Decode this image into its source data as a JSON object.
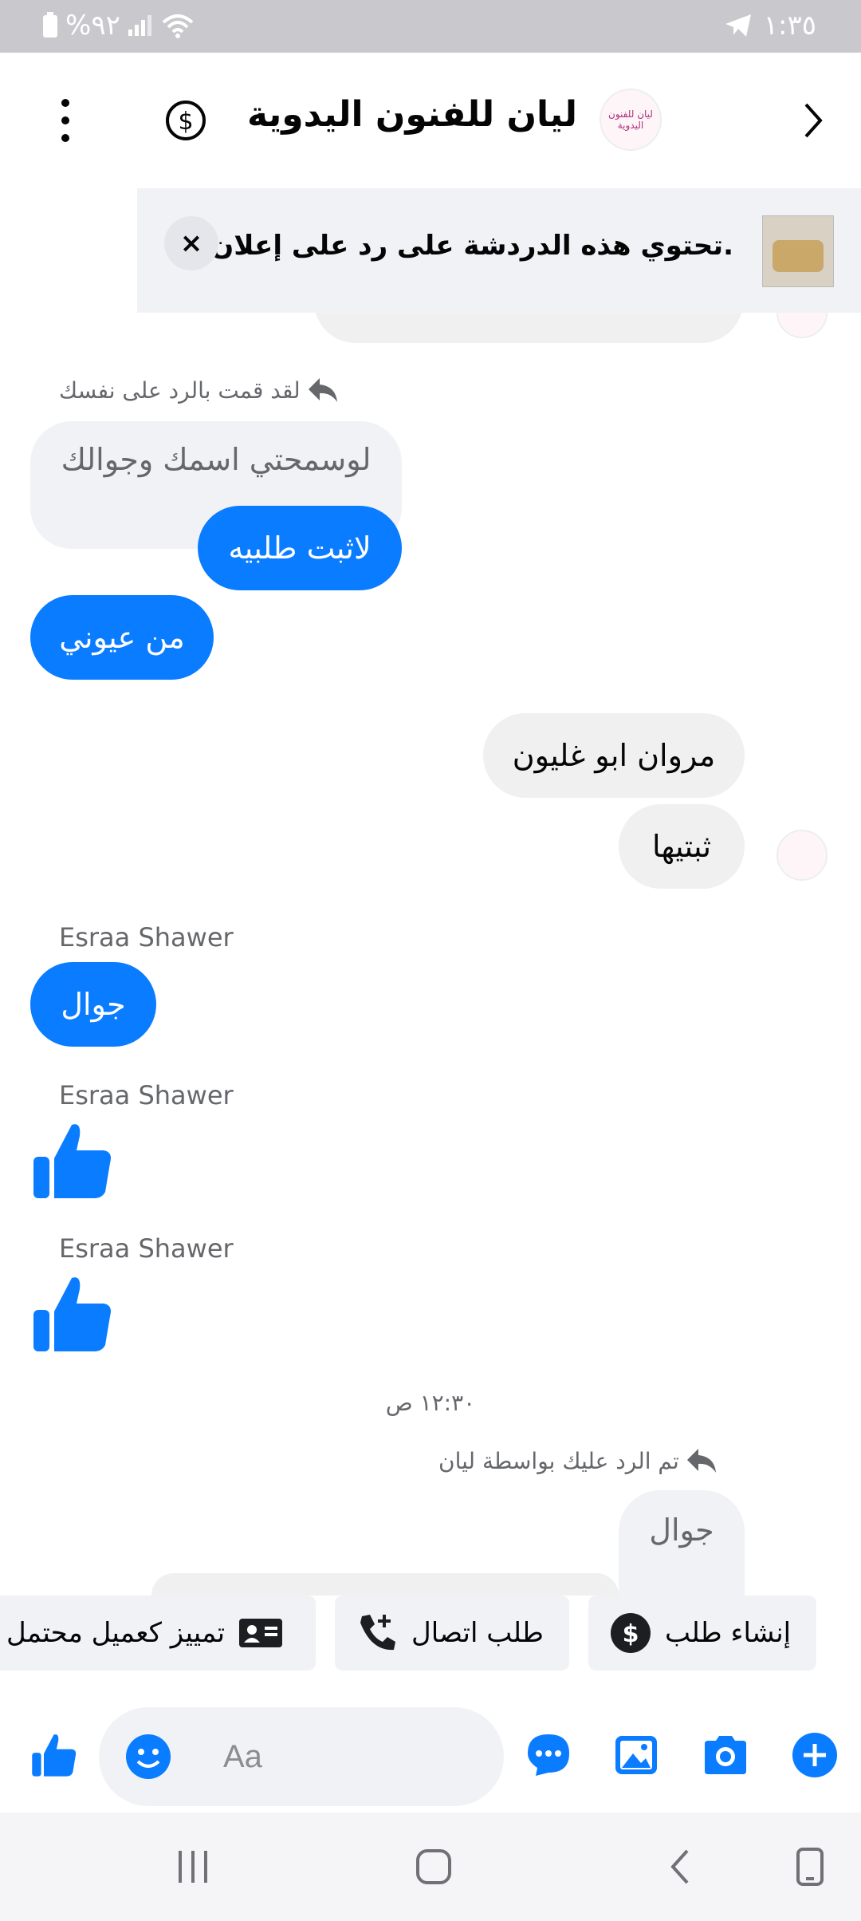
{
  "status_bar": {
    "time": "١:٣٥",
    "battery": "%٩٢",
    "signal_icon": "signal-icon",
    "wifi_icon": "wifi-icon",
    "telegram_icon": "telegram-icon"
  },
  "header": {
    "title": "ليان للفنون اليدوية",
    "avatar_text": "ليان للفنون اليدوية",
    "back_icon": "chevron-back-icon",
    "dollar_icon": "dollar-icon",
    "more_icon": "more-vertical-icon"
  },
  "ad_banner": {
    "text": "تحتوي هذه الدردشة على رد على إعلان ما.",
    "close_label": "×"
  },
  "messages": {
    "replied_yourself": "لقد قمت بالرد على نفسك",
    "quoted_request": "لوسمحتي اسمك وجوالك",
    "confirm_order": "لاثبت طلبيه",
    "my_pleasure": "من عيوني",
    "customer_name": "مروان ابو غليون",
    "confirm_it": "ثبتيها",
    "sender_1": "Esraa Shawer",
    "mobile": "جوال",
    "sender_2": "Esraa Shawer",
    "sender_3": "Esraa Shawer",
    "timestamp": "١٢:٣٠ ص",
    "replied_by": "تم الرد عليك بواسطة ليان",
    "quoted_mobile": "جوال"
  },
  "quick_actions": {
    "create_order": "إنشاء طلب",
    "request_call": "طلب اتصال",
    "mark_lead": "تمييز كعميل محتمل"
  },
  "composer": {
    "placeholder": "Aa"
  },
  "colors": {
    "accent": "#0a7cff",
    "bubble_gray": "#f0f0f0",
    "status_bar": "#c9c9cd"
  }
}
